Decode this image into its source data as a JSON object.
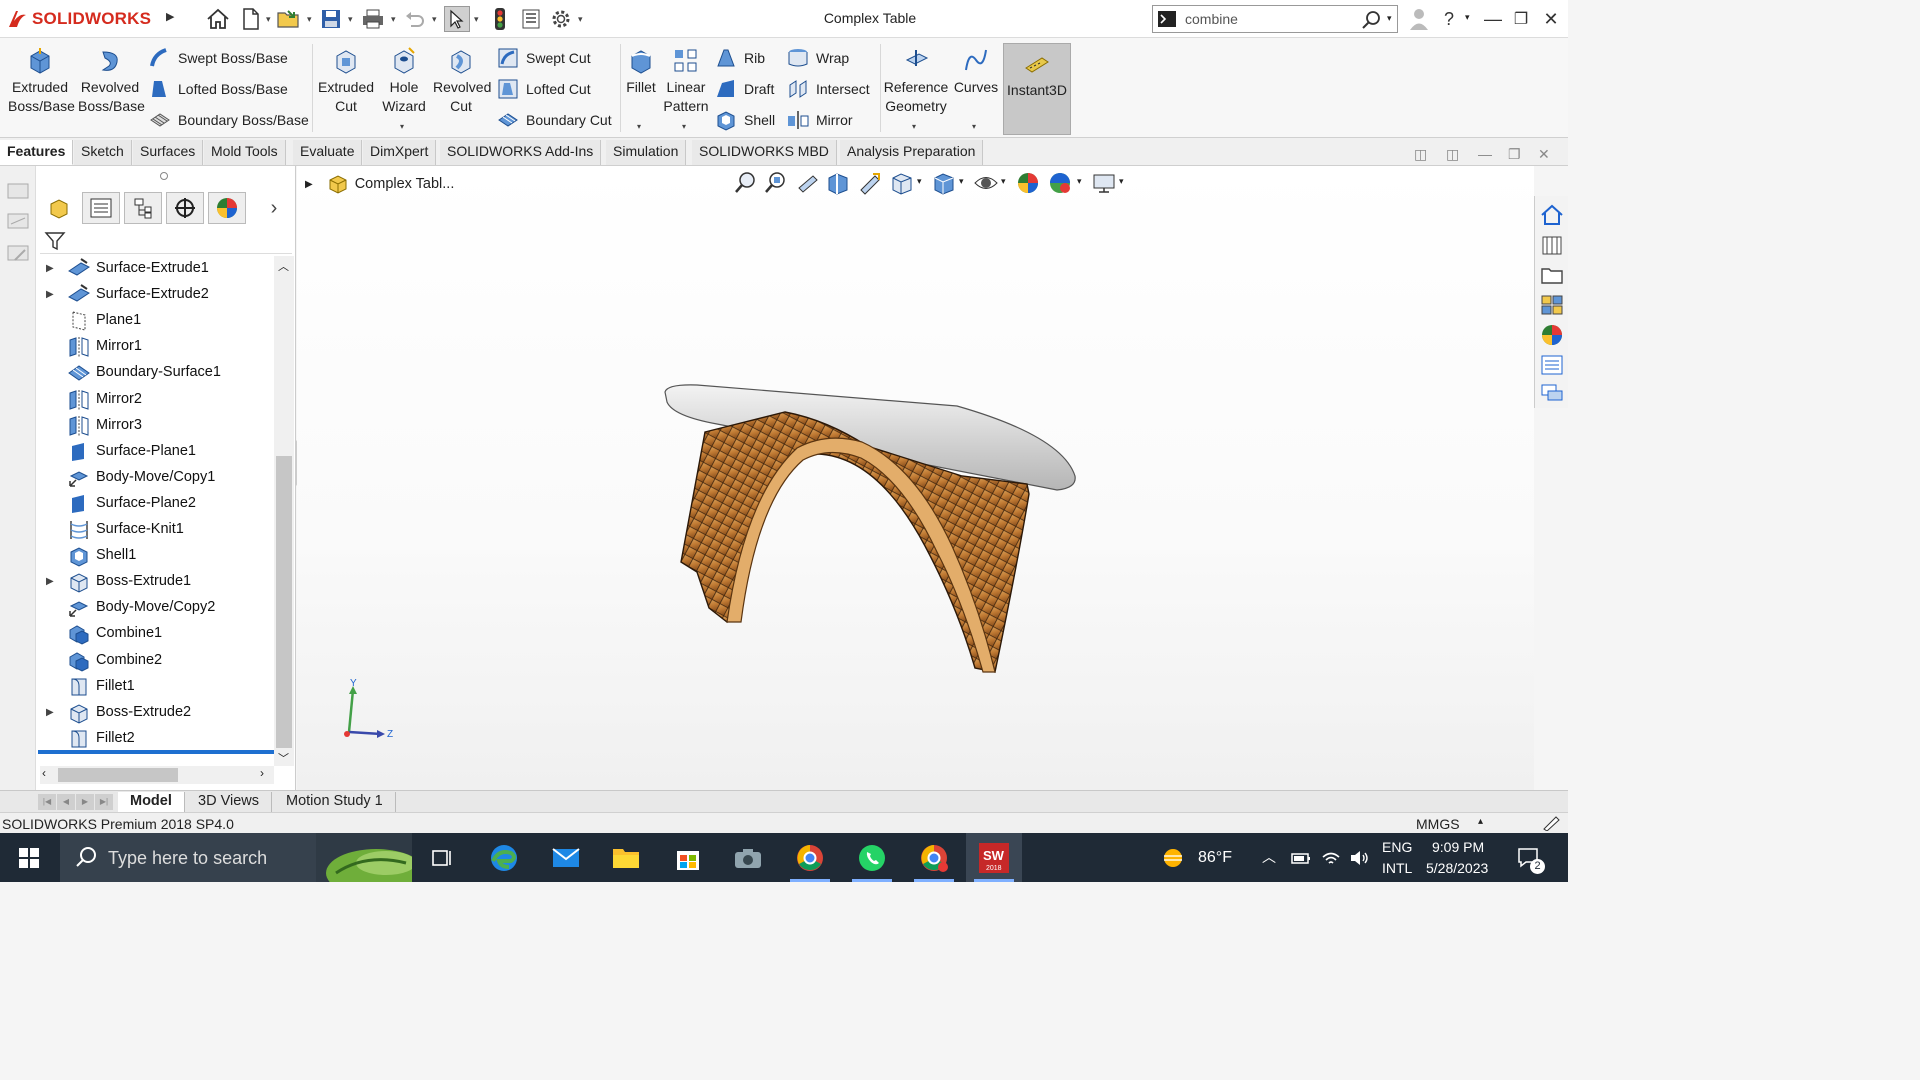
{
  "app": {
    "brand": "SOLIDWORKS",
    "title": "Complex Table",
    "search_value": "combine",
    "brand_color": "#d52b1e"
  },
  "ribbon": {
    "extruded_boss": "Extruded Boss/Base",
    "revolved_boss": "Revolved Boss/Base",
    "swept_boss": "Swept Boss/Base",
    "lofted_boss": "Lofted Boss/Base",
    "boundary_boss": "Boundary Boss/Base",
    "extruded_cut": "Extruded Cut",
    "hole_wizard": "Hole Wizard",
    "revolved_cut": "Revolved Cut",
    "swept_cut": "Swept Cut",
    "lofted_cut": "Lofted Cut",
    "boundary_cut": "Boundary Cut",
    "fillet": "Fillet",
    "linear_pattern": "Linear Pattern",
    "rib": "Rib",
    "draft": "Draft",
    "shell": "Shell",
    "wrap": "Wrap",
    "intersect": "Intersect",
    "mirror": "Mirror",
    "reference_geometry": "Reference Geometry",
    "curves": "Curves",
    "instant3d": "Instant3D"
  },
  "tabs": [
    "Features",
    "Sketch",
    "Surfaces",
    "Mold Tools",
    "Evaluate",
    "DimXpert",
    "SOLIDWORKS Add-Ins",
    "Simulation",
    "SOLIDWORKS MBD",
    "Analysis Preparation"
  ],
  "breadcrumb": "Complex Tabl...",
  "tree": [
    {
      "label": "Surface-Extrude1",
      "expandable": true,
      "icon": "surface-extrude-icon"
    },
    {
      "label": "Surface-Extrude2",
      "expandable": true,
      "icon": "surface-extrude-icon"
    },
    {
      "label": "Plane1",
      "expandable": false,
      "icon": "plane-icon"
    },
    {
      "label": "Mirror1",
      "expandable": false,
      "icon": "mirror-icon"
    },
    {
      "label": "Boundary-Surface1",
      "expandable": false,
      "icon": "boundary-surface-icon"
    },
    {
      "label": "Mirror2",
      "expandable": false,
      "icon": "mirror-icon"
    },
    {
      "label": "Mirror3",
      "expandable": false,
      "icon": "mirror-icon"
    },
    {
      "label": "Surface-Plane1",
      "expandable": false,
      "icon": "surface-plane-icon"
    },
    {
      "label": "Body-Move/Copy1",
      "expandable": false,
      "icon": "move-copy-icon"
    },
    {
      "label": "Surface-Plane2",
      "expandable": false,
      "icon": "surface-plane-icon"
    },
    {
      "label": "Surface-Knit1",
      "expandable": false,
      "icon": "knit-icon"
    },
    {
      "label": "Shell1",
      "expandable": false,
      "icon": "shell-icon"
    },
    {
      "label": "Boss-Extrude1",
      "expandable": true,
      "icon": "boss-extrude-icon"
    },
    {
      "label": "Body-Move/Copy2",
      "expandable": false,
      "icon": "move-copy-icon"
    },
    {
      "label": "Combine1",
      "expandable": false,
      "icon": "combine-icon"
    },
    {
      "label": "Combine2",
      "expandable": false,
      "icon": "combine-icon"
    },
    {
      "label": "Fillet1",
      "expandable": false,
      "icon": "fillet-icon"
    },
    {
      "label": "Boss-Extrude2",
      "expandable": true,
      "icon": "boss-extrude-icon"
    },
    {
      "label": "Fillet2",
      "expandable": false,
      "icon": "fillet-icon"
    }
  ],
  "triad": {
    "y": "Y",
    "z": "Z"
  },
  "bottom_tabs": [
    "Model",
    "3D Views",
    "Motion Study 1"
  ],
  "status": {
    "version": "SOLIDWORKS Premium 2018 SP4.0",
    "units": "MMGS"
  },
  "taskbar": {
    "search_placeholder": "Type here to search",
    "temperature": "86°F",
    "lang_line1": "ENG",
    "lang_line2": "INTL",
    "time": "9:09 PM",
    "date": "5/28/2023",
    "notifications": "2",
    "sw_badge": "2018"
  }
}
